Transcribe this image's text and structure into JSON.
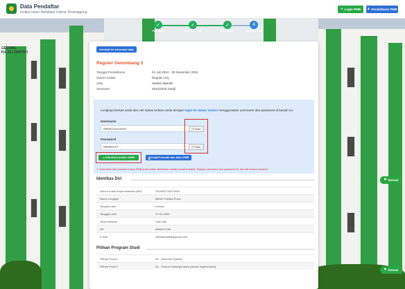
{
  "header": {
    "title": "Data Pendaftar",
    "subtitle": "Institut Islam Nahdlatul Ulama Temanggung",
    "login_button": "Login PMB",
    "daftar_button": "Pendaftaran PMB"
  },
  "stepper": {
    "steps": [
      {
        "label": "Pilih Jalur",
        "status": "done"
      },
      {
        "label": "Informasi data",
        "status": "done"
      },
      {
        "label": "Isi Formulir",
        "status": "done"
      },
      {
        "label": "Dapatkan Akun",
        "status": "current"
      }
    ]
  },
  "building": {
    "sign": [
      "GEDUNG",
      "HJ. ALI DIMYATI"
    ]
  },
  "card": {
    "back_button": "Kembali ke informasi data",
    "title": "Reguler Gelombang 3",
    "info": [
      {
        "label": "Tanggal Pendaftaran",
        "value": "01 Juli 2024 - 30 November 2024"
      },
      {
        "label": "Sistem Kuliah",
        "value": "Reguler (01)"
      },
      {
        "label": "Jalur",
        "value": "Seleksi Mandiri"
      },
      {
        "label": "Semester",
        "value": "2024/2025 Ganjil"
      }
    ],
    "login_box": {
      "text_before": "Lengkapi berkas anda dan cek status terbaru anda dengan",
      "link": "login ke dalam sistem",
      "text_after": "menggunakan username dan password di bawah ini.",
      "username_label": "Username",
      "username_value": "I8000123123321",
      "password_label": "Password",
      "password_value": "I8000012T····",
      "copy_label": "Salin",
      "login_button": "Klik disini untuk LOGIN",
      "print_button": "Cetak Formulir dan Akun PMB",
      "warning": "Username dan password akun PMB anda sudah dikirimkan melalui email terdaftar. Simpan username dan password ini, lalu klik tombol tersebut."
    },
    "identitas": {
      "title": "Identitas Diri",
      "rows": [
        {
          "key": "Nomor Induk Kependudukan (NIK)",
          "value": "3324052704010001"
        },
        {
          "key": "Nama Lengkap",
          "value": "Miftah Pradika Putra"
        },
        {
          "key": "Tempat Lahir",
          "value": "Kendal"
        },
        {
          "key": "Tanggal Lahir",
          "value": "27-04-2000"
        },
        {
          "key": "Jenis Kelamin",
          "value": "Laki-Laki"
        },
        {
          "key": "HP",
          "value": "0889237249"
        },
        {
          "key": "E-mail",
          "value": "miftahpradika@gmail.com"
        }
      ]
    },
    "prodi": {
      "title": "Pilihan Program Studi",
      "rows": [
        {
          "key": "Pilihan Prodi 1",
          "value": "S1 - Ekonomi Syariah"
        },
        {
          "key": "Pilihan Prodi 2",
          "value": "S1 - Hukum Keluarga Islam (Ahwal Syakhshiyah)"
        }
      ]
    }
  },
  "floating_buttons": [
    "Donasi",
    "Donasi"
  ],
  "colors": {
    "accent": "#2e6fd6",
    "success": "#28a745",
    "title": "#e8552a",
    "warning": "#d32f2f"
  }
}
